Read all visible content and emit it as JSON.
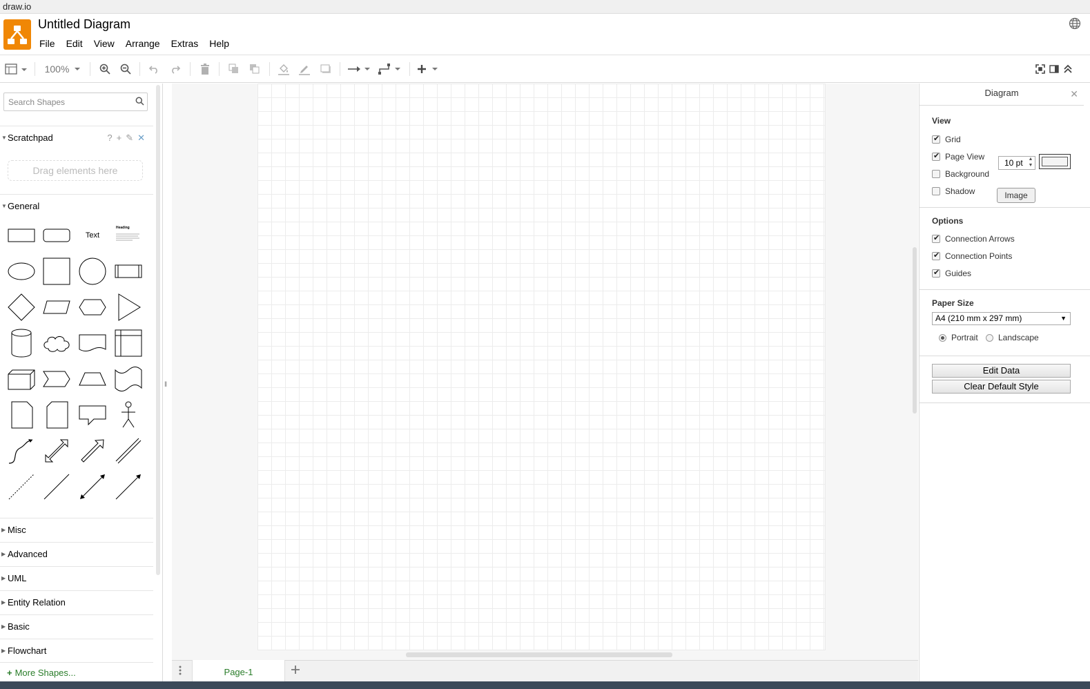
{
  "window": {
    "title": "draw.io"
  },
  "header": {
    "title": "Untitled Diagram",
    "menu": [
      "File",
      "Edit",
      "View",
      "Arrange",
      "Extras",
      "Help"
    ]
  },
  "toolbar": {
    "zoom": "100%"
  },
  "sidebar": {
    "search": {
      "placeholder": "Search Shapes",
      "value": ""
    },
    "scratchpad": {
      "label": "Scratchpad",
      "drop_hint": "Drag elements here",
      "tools": [
        "?",
        "+",
        "✎",
        "✕"
      ]
    },
    "general": {
      "label": "General",
      "text_shape": "Text",
      "heading_shape": "Heading"
    },
    "sections": [
      "Misc",
      "Advanced",
      "UML",
      "Entity Relation",
      "Basic",
      "Flowchart"
    ],
    "more_shapes": "More Shapes..."
  },
  "pages": {
    "tabs": [
      "Page-1"
    ]
  },
  "format": {
    "title": "Diagram",
    "view": {
      "heading": "View",
      "grid": {
        "label": "Grid",
        "checked": true,
        "size": "10 pt"
      },
      "page_view": {
        "label": "Page View",
        "checked": true
      },
      "background": {
        "label": "Background",
        "checked": false,
        "button": "Image"
      },
      "shadow": {
        "label": "Shadow",
        "checked": false
      }
    },
    "options": {
      "heading": "Options",
      "connection_arrows": {
        "label": "Connection Arrows",
        "checked": true
      },
      "connection_points": {
        "label": "Connection Points",
        "checked": true
      },
      "guides": {
        "label": "Guides",
        "checked": true
      }
    },
    "paper": {
      "heading": "Paper Size",
      "size": "A4 (210 mm x 297 mm)",
      "portrait": "Portrait",
      "landscape": "Landscape",
      "orientation": "portrait"
    },
    "buttons": {
      "edit_data": "Edit Data",
      "clear_style": "Clear Default Style"
    }
  },
  "colors": {
    "logo": "#f08705",
    "accent_green": "#2a7d2a"
  }
}
